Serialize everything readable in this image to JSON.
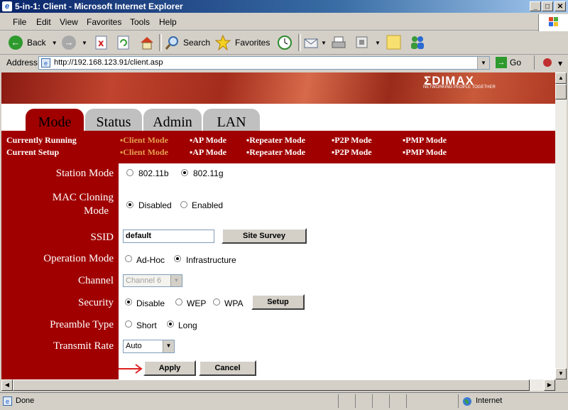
{
  "window": {
    "title": "5-in-1: Client - Microsoft Internet Explorer"
  },
  "menu": [
    "File",
    "Edit",
    "View",
    "Favorites",
    "Tools",
    "Help"
  ],
  "toolbar": {
    "back": "Back",
    "search": "Search",
    "favorites": "Favorites"
  },
  "address": {
    "label": "Address",
    "url": "http://192.168.123.91/client.asp",
    "go": "Go"
  },
  "brand": {
    "logo": "ΣDIMAX",
    "tagline": "NETWORKING PEOPLE TOGETHER"
  },
  "tabs": [
    "Mode",
    "Status",
    "Admin",
    "LAN"
  ],
  "mode_bar": {
    "currently_running_label": "Currently Running",
    "current_setup_label": "Current Setup",
    "modes": [
      "▪Client Mode",
      "▪AP Mode",
      "▪Repeater Mode",
      "▪P2P Mode",
      "▪PMP Mode"
    ]
  },
  "form": {
    "station_mode": {
      "label": "Station Mode",
      "options": [
        "802.11b",
        "802.11g"
      ],
      "selected": "802.11g"
    },
    "mac_cloning": {
      "label_line1": "MAC Cloning",
      "label_line2": "Mode",
      "options": [
        "Disabled",
        "Enabled"
      ],
      "selected": "Disabled"
    },
    "ssid": {
      "label": "SSID",
      "value": "default",
      "site_survey": "Site Survey"
    },
    "operation_mode": {
      "label": "Operation Mode",
      "options": [
        "Ad-Hoc",
        "Infrastructure"
      ],
      "selected": "Infrastructure"
    },
    "channel": {
      "label": "Channel",
      "value": "Channel 6"
    },
    "security": {
      "label": "Security",
      "options": [
        "Disable",
        "WEP",
        "WPA"
      ],
      "selected": "Disable",
      "setup": "Setup"
    },
    "preamble": {
      "label": "Preamble Type",
      "options": [
        "Short",
        "Long"
      ],
      "selected": "Long"
    },
    "transmit_rate": {
      "label": "Transmit Rate",
      "value": "Auto"
    },
    "apply": "Apply",
    "cancel": "Cancel"
  },
  "status": {
    "text": "Done",
    "zone": "Internet"
  },
  "colors": {
    "brand_red": "#a00000",
    "tab_gray": "#c0c0c0",
    "active_mode": "#e6a050"
  }
}
